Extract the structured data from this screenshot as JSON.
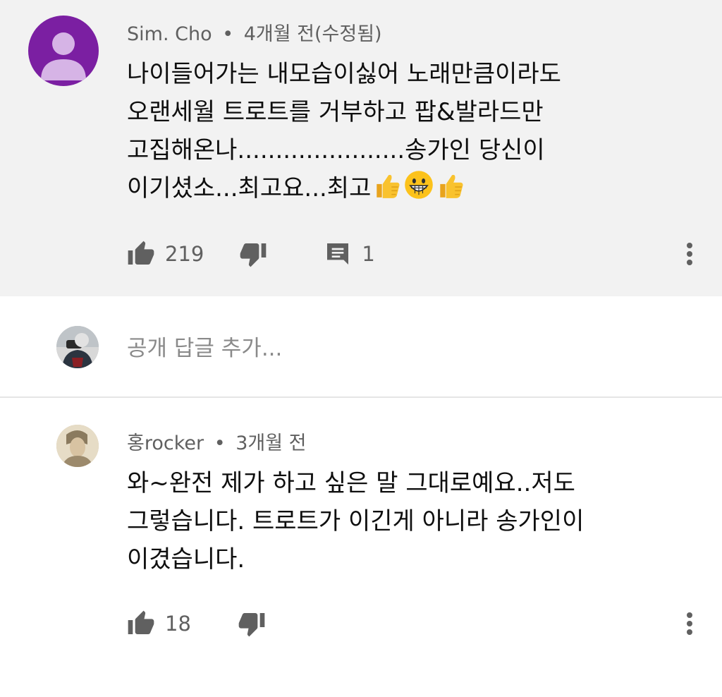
{
  "comment1": {
    "author": "Sim. Cho",
    "separator": "•",
    "time": "4개월 전(수정됨)",
    "lines": [
      "나이들어가는  내모습이싫어  노래만큼이라도",
      "오랜세월 트로트를  거부하고  팝&발라드만",
      "고집해온나......................송가인  당신이",
      "이기셨소...최고요...최고"
    ],
    "emojis": [
      "thumbs-up-emoji",
      "grinning-face-emoji",
      "thumbs-up-emoji"
    ],
    "likes": "219",
    "replies": "1"
  },
  "reply_box": {
    "placeholder": "공개 답글 추가..."
  },
  "comment2": {
    "author": "홍rocker",
    "separator": "•",
    "time": "3개월 전",
    "lines": [
      "와~완전 제가 하고 싶은 말 그대로예요..저도",
      "그렇습니다. 트로트가 이긴게 아니라 송가인이",
      "이겼습니다."
    ],
    "likes": "18"
  },
  "colors": {
    "highlight_bg": "#f2f2f2",
    "avatar_purple": "#7b1fa2",
    "icon_gray": "#606060"
  }
}
